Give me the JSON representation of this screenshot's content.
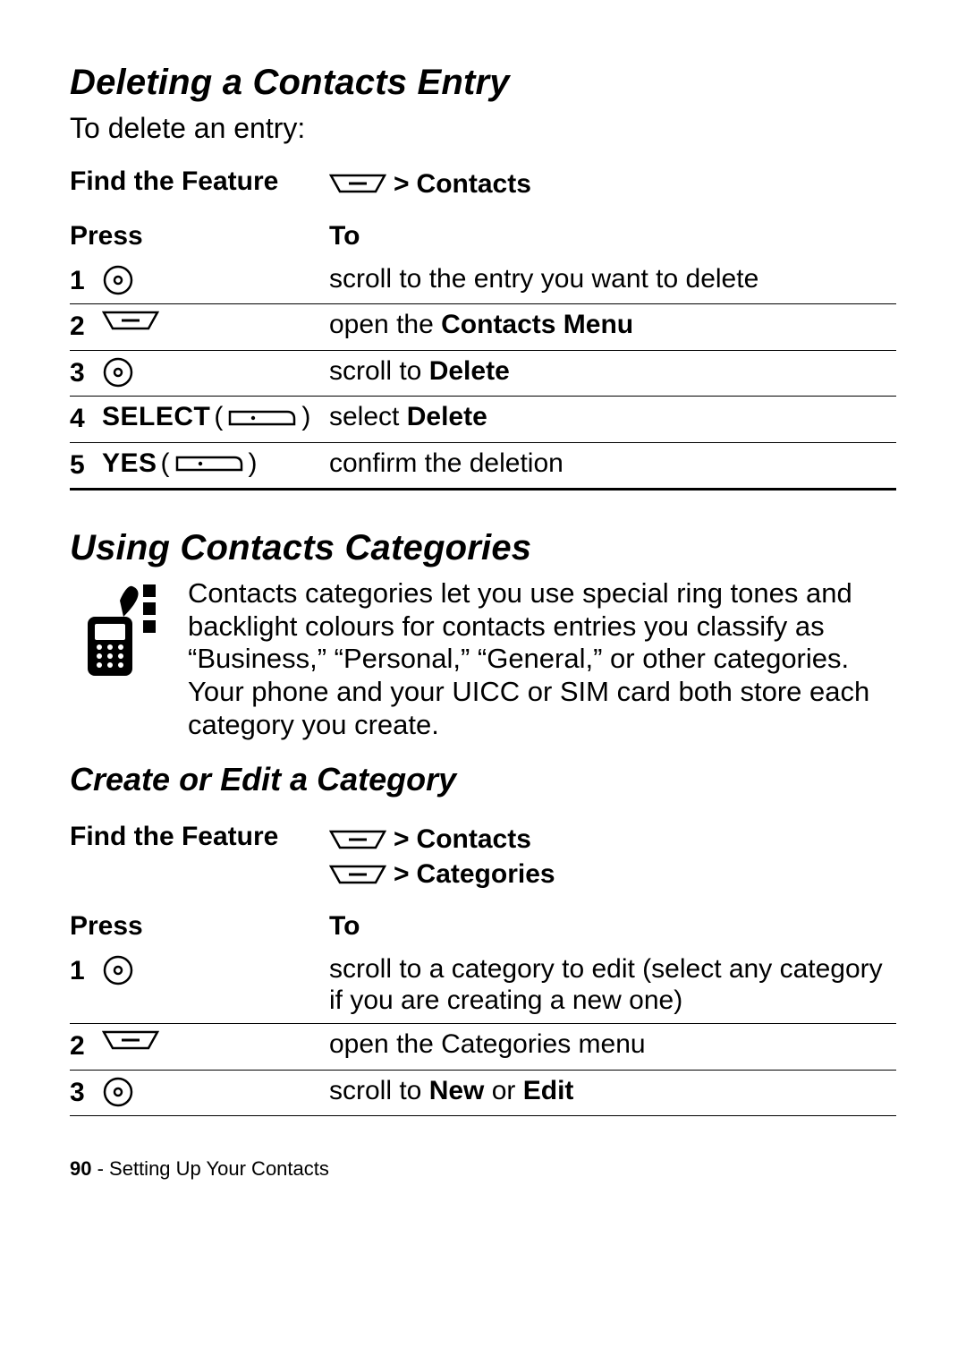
{
  "section1": {
    "title": "Deleting a Contacts Entry",
    "intro": "To delete an entry:",
    "feature_label": "Find the Feature",
    "path": [
      {
        "icon": "menu",
        "text": "Contacts"
      }
    ],
    "headers": {
      "press": "Press",
      "to": "To"
    },
    "steps": [
      {
        "num": "1",
        "press": {
          "icon": "nav"
        },
        "to_plain": "scroll to the entry you want to delete"
      },
      {
        "num": "2",
        "press": {
          "icon": "menu"
        },
        "to_prefix": "open the ",
        "to_bold": "Contacts Menu"
      },
      {
        "num": "3",
        "press": {
          "icon": "nav"
        },
        "to_prefix": "scroll to ",
        "to_bold": "Delete"
      },
      {
        "num": "4",
        "press": {
          "label": "SELECT",
          "icon": "softkey"
        },
        "to_prefix": "select ",
        "to_bold": "Delete"
      },
      {
        "num": "5",
        "press": {
          "label": "YES",
          "icon": "softkey"
        },
        "to_plain": "confirm the deletion"
      }
    ]
  },
  "section2": {
    "title": "Using Contacts Categories",
    "description": "Contacts categories let you use special ring tones and backlight colours for contacts entries you classify as “Business,” “Personal,” “General,” or other categories. Your phone and your UICC or SIM card both store each category you create.",
    "subtitle": "Create or Edit a Category",
    "feature_label": "Find the Feature",
    "path": [
      {
        "icon": "menu",
        "text": "Contacts"
      },
      {
        "icon": "menu",
        "text": "Categories"
      }
    ],
    "headers": {
      "press": "Press",
      "to": "To"
    },
    "steps": [
      {
        "num": "1",
        "press": {
          "icon": "nav"
        },
        "to_plain": "scroll to a category to edit (select any category if you are creating a new one)"
      },
      {
        "num": "2",
        "press": {
          "icon": "menu"
        },
        "to_plain": "open the Categories menu"
      },
      {
        "num": "3",
        "press": {
          "icon": "nav"
        },
        "to_prefix": "scroll to ",
        "to_bold": "New",
        "to_middle": " or ",
        "to_bold2": "Edit"
      }
    ]
  },
  "footer": {
    "page": "90",
    "sep": " - ",
    "chapter": "Setting Up Your Contacts"
  }
}
